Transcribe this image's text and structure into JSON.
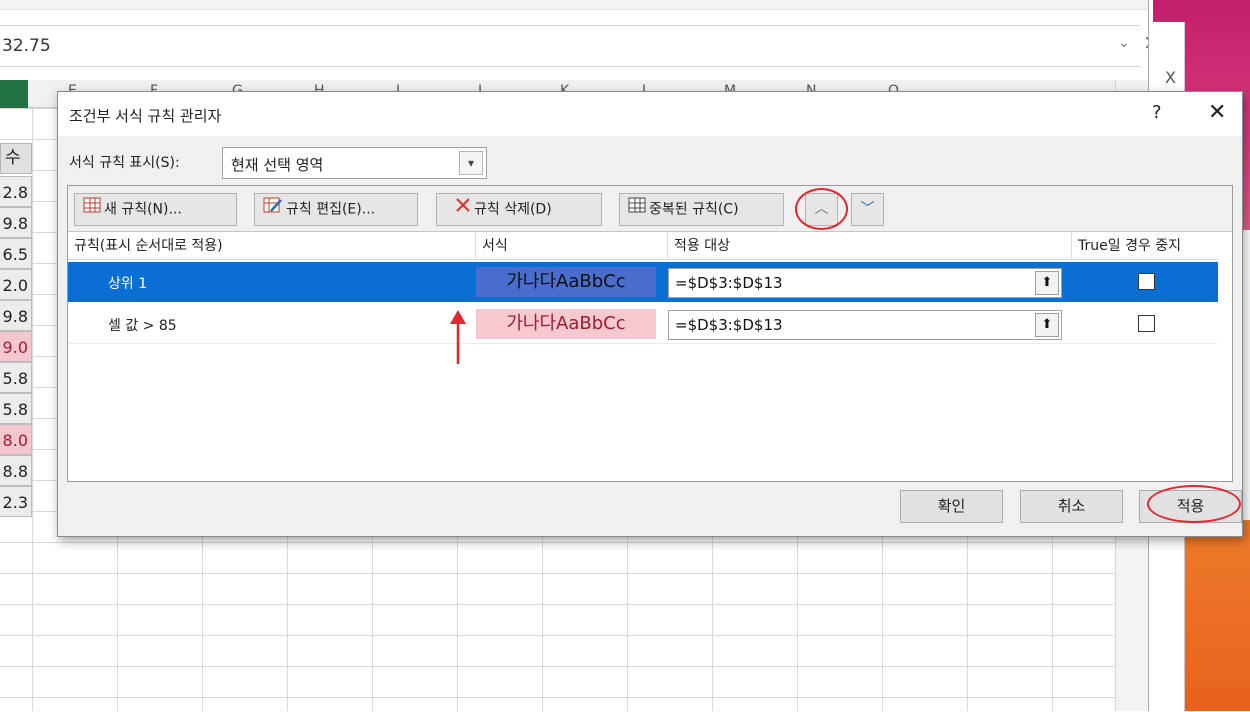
{
  "excel": {
    "formula_value": "32.75",
    "formula_dropdown_icon": "chevron-down-icon",
    "column_letters": [
      "E",
      "F",
      "G",
      "H",
      "I",
      "J",
      "K",
      "L",
      "M",
      "N",
      "O"
    ],
    "column_head_cell": "수",
    "cell_values": [
      {
        "value": "2.8",
        "highlight": false
      },
      {
        "value": "9.8",
        "highlight": false
      },
      {
        "value": "6.5",
        "highlight": false
      },
      {
        "value": "2.0",
        "highlight": false
      },
      {
        "value": "9.8",
        "highlight": false
      },
      {
        "value": "9.0",
        "highlight": true
      },
      {
        "value": "5.8",
        "highlight": false
      },
      {
        "value": "5.8",
        "highlight": false
      },
      {
        "value": "8.0",
        "highlight": true
      },
      {
        "value": "8.8",
        "highlight": false
      },
      {
        "value": "2.3",
        "highlight": false
      }
    ],
    "close_glyph": "×"
  },
  "right_panel": {
    "x_glyph": "X"
  },
  "dialog": {
    "title": "조건부 서식 규칙 관리자",
    "help": "?",
    "close": "✕",
    "show_rules_label": "서식 규칙 표시(S):",
    "show_rules_value": "현재 선택 영역",
    "toolbar": {
      "new_rule": "새 규칙(N)...",
      "edit_rule": "규칙 편집(E)...",
      "delete_rule": "규칙 삭제(D)",
      "duplicate_rule": "중복된 규칙(C)",
      "move_up_glyph": "︿",
      "move_down_glyph": "﹀"
    },
    "columns": {
      "rule": "규칙(표시 순서대로 적용)",
      "format": "서식",
      "applies_to": "적용 대상",
      "stop_if_true": "True일 경우 중지"
    },
    "rules": [
      {
        "name": "상위 1",
        "preview": "가나다AaBbCc",
        "applies_to": "=$D$3:$D$13",
        "stop_if_true": false,
        "selected": true
      },
      {
        "name": "셀 값 > 85",
        "preview": "가나다AaBbCc",
        "applies_to": "=$D$3:$D$13",
        "stop_if_true": false,
        "selected": false
      }
    ],
    "buttons": {
      "ok": "확인",
      "cancel": "취소",
      "apply": "적용"
    }
  },
  "colors": {
    "selected_row": "#0a6fd2",
    "annotation_red": "#e0262e",
    "preview_blue": "#4a6ccc",
    "preview_pink": "#f6c8d0",
    "preview_pink_text": "#9c1e2d"
  }
}
